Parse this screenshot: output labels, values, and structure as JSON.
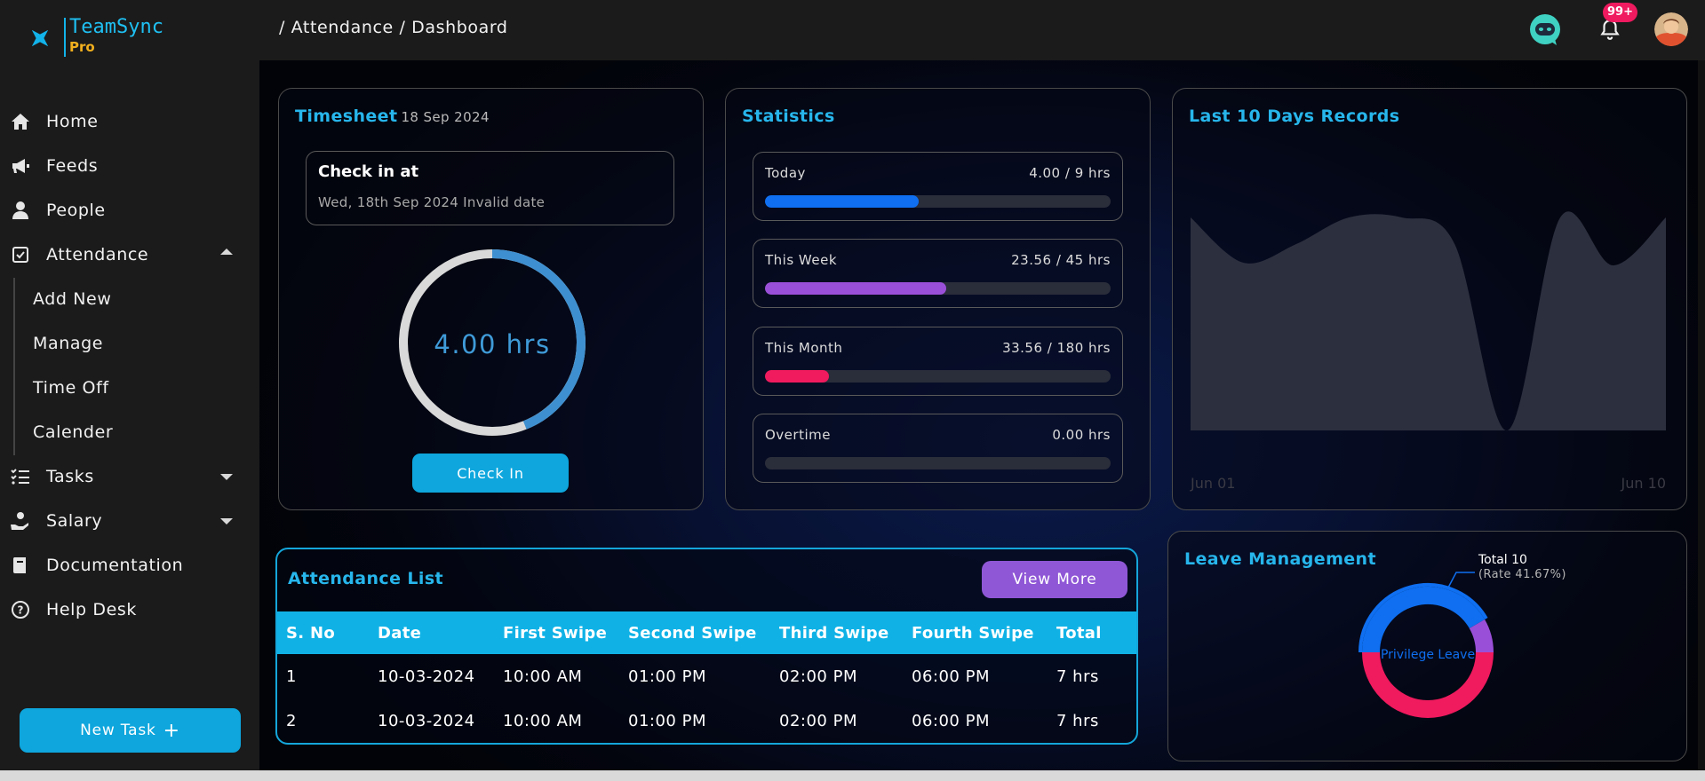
{
  "app": {
    "name": "TeamSync",
    "edition": "Pro"
  },
  "header": {
    "breadcrumb": "/ Attendance / Dashboard",
    "notification_count": "99+"
  },
  "sidebar": {
    "items": [
      {
        "label": "Home",
        "icon": "home-icon"
      },
      {
        "label": "Feeds",
        "icon": "megaphone-icon"
      },
      {
        "label": "People",
        "icon": "person-icon"
      },
      {
        "label": "Attendance",
        "icon": "checkbox-icon",
        "expanded": true
      },
      {
        "label": "Tasks",
        "icon": "list-icon",
        "expanded": false
      },
      {
        "label": "Salary",
        "icon": "salary-hand-icon",
        "expanded": false
      },
      {
        "label": "Documentation",
        "icon": "book-icon"
      },
      {
        "label": "Help Desk",
        "icon": "help-icon"
      }
    ],
    "attendance_sub": [
      "Add New",
      "Manage",
      "Time Off",
      "Calender"
    ],
    "new_task_label": "New Task"
  },
  "timesheet": {
    "title": "Timesheet",
    "date": "18 Sep 2024",
    "checkin_title": "Check in at",
    "checkin_sub": "Wed, 18th Sep 2024 Invalid date",
    "hours_display": "4.00 hrs",
    "ring_progress": 0.44,
    "checkin_button": "Check In"
  },
  "statistics": {
    "title": "Statistics",
    "rows": [
      {
        "label": "Today",
        "value": "4.00 / 9 hrs",
        "progress": 0.444,
        "color": "#0f6ff0"
      },
      {
        "label": "This Week",
        "value": "23.56 / 45 hrs",
        "progress": 0.524,
        "color": "#9a4fd8"
      },
      {
        "label": "This Month",
        "value": "33.56 / 180 hrs",
        "progress": 0.186,
        "color": "#f01a5e"
      },
      {
        "label": "Overtime",
        "value": "0.00 hrs",
        "progress": 0,
        "color": "#0f6ff0"
      }
    ]
  },
  "records": {
    "title": "Last 10 Days Records",
    "x_start_label": "Jun 01",
    "x_end_label": "Jun 10"
  },
  "chart_data": {
    "type": "area",
    "title": "Last 10 Days Records",
    "x": [
      "Jun 01",
      "",
      "",
      "",
      "",
      "",
      "",
      "",
      "",
      "Jun 10"
    ],
    "series": [
      {
        "values": [
          8.0,
          6.3,
          7.0,
          8.0,
          8.0,
          7.0,
          0.0,
          8.0,
          6.2,
          8.0
        ]
      }
    ],
    "ylim": [
      0,
      10
    ],
    "grid": false,
    "colors": {
      "fill": "#2c2f3e"
    }
  },
  "attendance_list": {
    "title": "Attendance List",
    "view_more": "View More",
    "columns": [
      "S. No",
      "Date",
      "First Swipe",
      "Second Swipe",
      "Third Swipe",
      "Fourth Swipe",
      "Total"
    ],
    "rows": [
      [
        "1",
        "10-03-2024",
        "10:00 AM",
        "01:00 PM",
        "02:00 PM",
        "06:00 PM",
        "7 hrs"
      ],
      [
        "2",
        "10-03-2024",
        "10:00 AM",
        "01:00 PM",
        "02:00 PM",
        "06:00 PM",
        "7 hrs"
      ]
    ]
  },
  "leave": {
    "title": "Leave Management",
    "total_label": "Total 10",
    "rate_label": "(Rate 41.67%)",
    "center_label": "Privilege Leave",
    "segments": [
      {
        "value": 0.4167,
        "color": "#0f6ff0"
      },
      {
        "value": 0.0833,
        "color": "#9a4fd8"
      },
      {
        "value": 0.5,
        "color": "#f01a5e"
      }
    ]
  },
  "colors": {
    "accent": "#27b6ec",
    "button": "#0ea6dd",
    "view_more": "#8f57d6",
    "badge": "#ef1a5f"
  }
}
